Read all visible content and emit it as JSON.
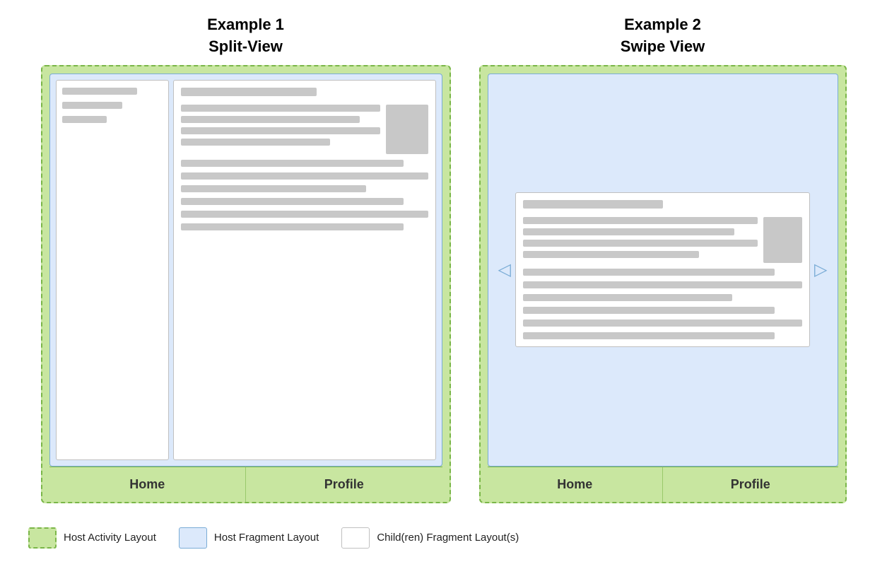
{
  "example1": {
    "title_line1": "Example 1",
    "title_line2": "Split-View",
    "nav_home": "Home",
    "nav_profile": "Profile"
  },
  "example2": {
    "title_line1": "Example 2",
    "title_line2": "Swipe View",
    "nav_home": "Home",
    "nav_profile": "Profile"
  },
  "legend": {
    "item1_label": "Host Activity Layout",
    "item2_label": "Host Fragment Layout",
    "item3_label": "Child(ren) Fragment Layout(s)"
  },
  "icons": {
    "arrow_left": "◁",
    "arrow_right": "▷"
  }
}
